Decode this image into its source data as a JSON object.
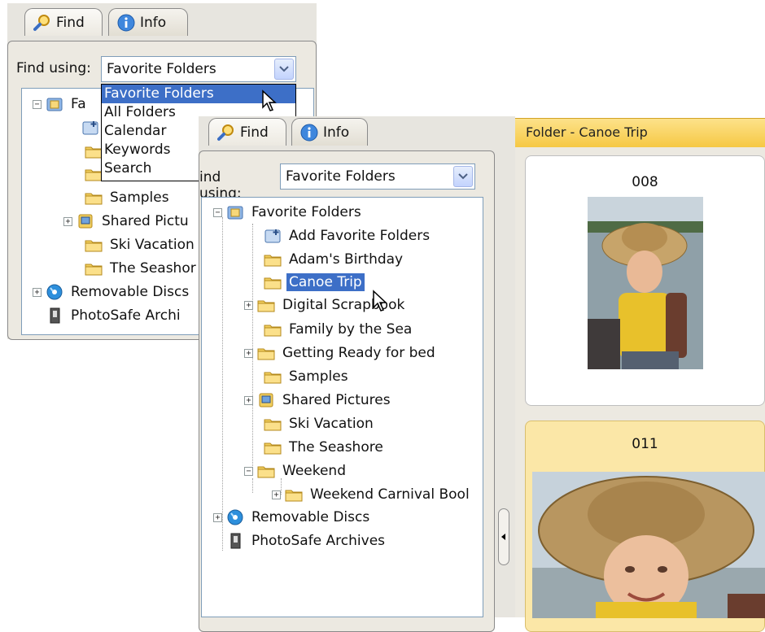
{
  "back_panel": {
    "tabs": {
      "find": "Find",
      "info": "Info"
    },
    "find_using_label": "Find using:",
    "find_using_value": "Favorite Folders",
    "dropdown_options": [
      "Favorite Folders",
      "All Folders",
      "Calendar",
      "Keywords",
      "Search"
    ],
    "tree": {
      "root_partial": "Fa",
      "samples": "Samples",
      "shared_pictures": "Shared Pictu",
      "ski_vacation": "Ski Vacation",
      "the_seashore": "The Seashor",
      "removable_discs": "Removable Discs",
      "photosafe": "PhotoSafe Archi"
    }
  },
  "front_panel": {
    "tabs": {
      "find": "Find",
      "info": "Info"
    },
    "find_using_label": "ind using:",
    "find_using_value": "Favorite Folders",
    "tree": {
      "favorite_folders": "Favorite Folders",
      "add_favorite_folders": "Add Favorite Folders",
      "adams_birthday": "Adam's Birthday",
      "canoe_trip": "Canoe Trip",
      "digital_scrapbook": "Digital Scrapbook",
      "family_by_the_sea": "Family by the Sea",
      "getting_ready": "Getting Ready for bed",
      "samples": "Samples",
      "shared_pictures": "Shared Pictures",
      "ski_vacation": "Ski Vacation",
      "the_seashore": "The Seashore",
      "weekend": "Weekend",
      "weekend_carnival": "Weekend Carnival Bool",
      "removable_discs": "Removable Discs",
      "photosafe": "PhotoSafe Archives"
    }
  },
  "photo_pane": {
    "folder_title": "Folder - Canoe Trip",
    "photos": [
      {
        "number": "008"
      },
      {
        "number": "011"
      }
    ]
  },
  "colors": {
    "selection": "#3d6fc7",
    "folder_bar": "#f6c844",
    "selected_card": "#fbe7a7"
  },
  "icons": {
    "find": "magnifier-icon",
    "info": "info-icon",
    "folder": "folder-icon",
    "favorites": "favorite-folders-icon",
    "disc": "disc-icon",
    "archive": "photosafe-icon"
  }
}
